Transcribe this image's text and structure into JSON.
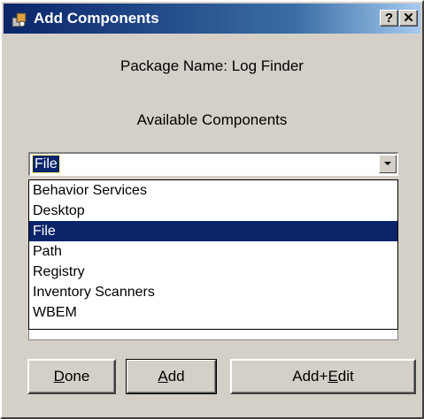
{
  "window": {
    "title": "Add Components",
    "help_label": "?",
    "close_label": "✕"
  },
  "package_line": "Package Name: Log Finder",
  "available_label": "Available Components",
  "combo": {
    "value": "File"
  },
  "dropdown": {
    "items": [
      {
        "label": "Behavior Services"
      },
      {
        "label": "Desktop"
      },
      {
        "label": "File",
        "selected": true
      },
      {
        "label": "Path"
      },
      {
        "label": "Registry"
      },
      {
        "label": "Inventory Scanners"
      },
      {
        "label": "WBEM"
      }
    ]
  },
  "buttons": {
    "done": {
      "mnemonic": "D",
      "rest": "one"
    },
    "add": {
      "mnemonic": "A",
      "rest": "dd"
    },
    "addedit": {
      "prefix": "Add+",
      "mnemonic": "E",
      "rest": "dit"
    }
  },
  "colors": {
    "selection": "#0a246a",
    "face": "#d4d0c8"
  }
}
